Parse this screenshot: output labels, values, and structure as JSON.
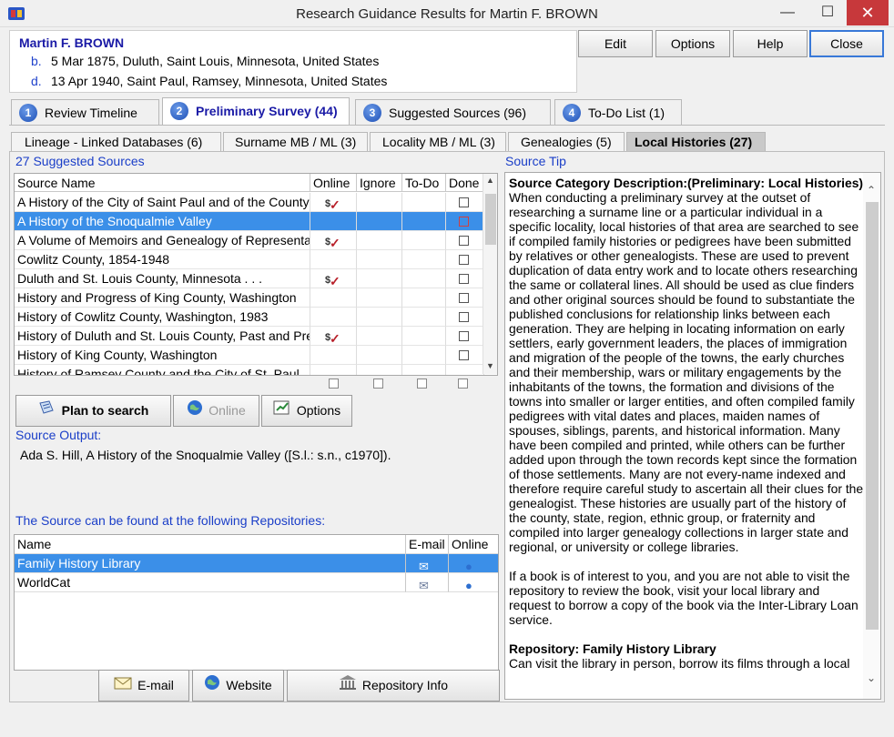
{
  "window": {
    "title": "Research Guidance Results for Martin F. BROWN",
    "min": "—",
    "max": "☐",
    "close": "✕"
  },
  "person": {
    "name": "Martin F. BROWN",
    "birth_label": "b.",
    "birth": "5 Mar 1875, Duluth, Saint Louis, Minnesota, United States",
    "death_label": "d.",
    "death": "13 Apr 1940, Saint Paul, Ramsey, Minnesota, United States"
  },
  "toolbar": {
    "edit": "Edit",
    "options": "Options",
    "help": "Help",
    "close": "Close"
  },
  "main_tabs": [
    {
      "num": "1",
      "label": "Review Timeline"
    },
    {
      "num": "2",
      "label": "Preliminary Survey (44)"
    },
    {
      "num": "3",
      "label": "Suggested Sources (96)"
    },
    {
      "num": "4",
      "label": "To-Do List (1)"
    }
  ],
  "sub_tabs": [
    "Lineage - Linked Databases (6)",
    "Surname MB / ML (3)",
    "Locality MB / ML (3)",
    "Genealogies (5)",
    "Local Histories (27)"
  ],
  "sources": {
    "count_label": "27 Suggested Sources",
    "headers": [
      "Source Name",
      "Online",
      "Ignore",
      "To-Do",
      "Done"
    ],
    "rows": [
      {
        "name": "A History of the City of Saint Paul and of the County of Ramsey",
        "online": true
      },
      {
        "name": "A History of the Snoqualmie Valley",
        "online": false,
        "selected": true
      },
      {
        "name": "A Volume of Memoirs and Genealogy of Representative Citizens",
        "online": true
      },
      {
        "name": "Cowlitz County, 1854-1948",
        "online": false
      },
      {
        "name": "Duluth and St. Louis County, Minnesota . . .",
        "online": true
      },
      {
        "name": "History and Progress of King County, Washington",
        "online": false
      },
      {
        "name": "History of Cowlitz County, Washington, 1983",
        "online": false
      },
      {
        "name": "History of Duluth and St. Louis County, Past and Present",
        "online": true
      },
      {
        "name": "History of King County, Washington",
        "online": false
      },
      {
        "name": "History of Ramsey County and the City of St. Paul",
        "online": false
      }
    ]
  },
  "source_buttons": {
    "plan": "Plan to search",
    "online": "Online",
    "options": "Options"
  },
  "source_output": {
    "label": "Source Output:",
    "text": "Ada S. Hill, A History of the Snoqualmie Valley ([S.l.: s.n., c1970])."
  },
  "repositories": {
    "label": "The Source can be found at the following Repositories:",
    "headers": [
      "Name",
      "E-mail",
      "Online"
    ],
    "rows": [
      {
        "name": "Family History Library",
        "selected": true
      },
      {
        "name": "WorldCat",
        "selected": false
      }
    ]
  },
  "repo_buttons": {
    "email": "E-mail",
    "website": "Website",
    "repo_info": "Repository Info"
  },
  "tip": {
    "label": "Source Tip",
    "heading": "Source Category Description:(Preliminary: Local Histories)",
    "para1": "When conducting a preliminary survey at the outset of researching a surname line or a particular individual in a specific locality, local histories of that area are searched to see if compiled family histories or pedigrees have been submitted by relatives or other genealogists. These are used to prevent duplication of data entry work and to locate others researching the same or collateral lines. All should be used as clue finders and other original sources should be found to substantiate the published conclusions for relationship links between each generation. They are helping in locating information on early settlers, early government leaders, the places of immigration and migration of the people of the towns, the early churches and their membership, wars or military engagements by the inhabitants of the towns, the formation and divisions of the towns into smaller or larger entities, and often compiled family pedigrees with vital dates and places, maiden names of spouses, siblings, parents, and historical information. Many have been compiled and printed, while others can be further added upon through the town records kept since the formation of those settlements. Many are not every-name indexed and therefore require careful study to ascertain all their clues for the genealogist. These histories are usually part of the history of the county, state, region, ethnic group, or fraternity and compiled into larger genealogy collections in larger state and regional, or university or college libraries.",
    "para2": "If a book is of interest to you, and you are not able to visit the repository to review the book, visit your local library and request to borrow a copy of the book via the Inter-Library Loan service.",
    "repo_heading": "Repository: Family History Library",
    "repo_text": "Can visit the library in person, borrow its films through a local"
  },
  "colors": {
    "accent": "#1a3ec8",
    "selection": "#3b8fe8",
    "close_red": "#c7383b"
  }
}
